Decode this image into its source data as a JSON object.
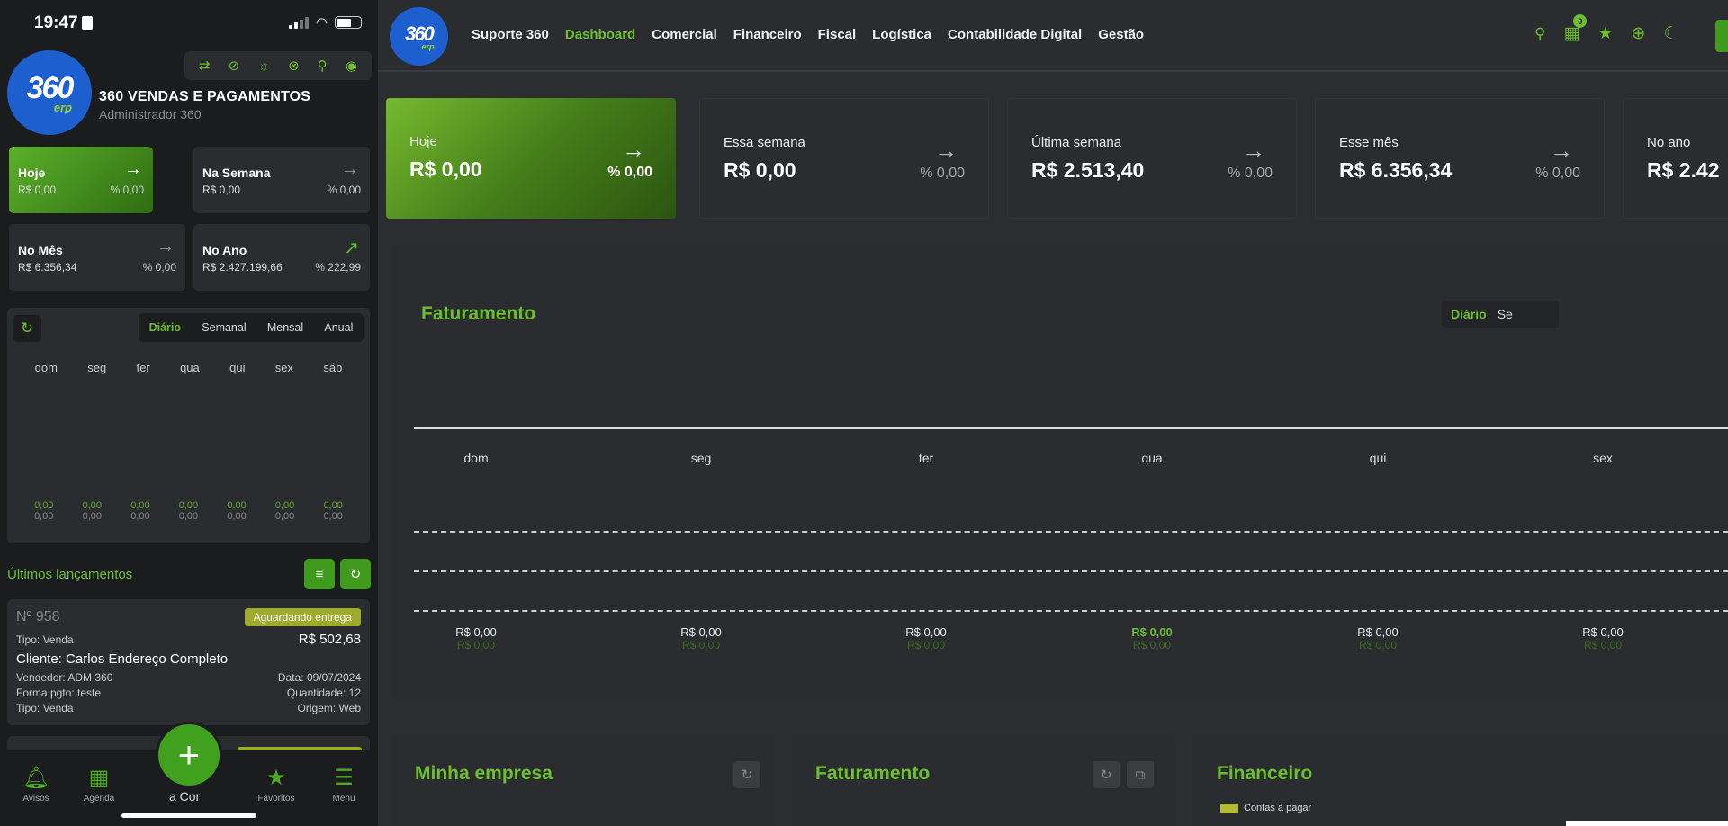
{
  "status": {
    "time": "19:47"
  },
  "profile": {
    "logo_main": "360",
    "logo_sub": "erp",
    "company": "360 VENDAS E PAGAMENTOS",
    "role": "Administrador  360"
  },
  "quick_icons": [
    "swap-icon",
    "no-location-icon",
    "brightness-icon",
    "eye-off-icon",
    "search-icon",
    "eye-icon"
  ],
  "m_cards": [
    {
      "title": "Hoje",
      "value": "R$ 0,00",
      "pct": "% 0,00",
      "arrow": "→"
    },
    {
      "title": "Na Semana",
      "value": "R$ 0,00",
      "pct": "% 0,00",
      "arrow": "→"
    },
    {
      "title": "No Mês",
      "value": "R$ 6.356,34",
      "pct": "% 0,00",
      "arrow": "→"
    },
    {
      "title": "No Ano",
      "value": "R$ 2.427.199,66",
      "pct": "% 222,99",
      "arrow": "↗"
    }
  ],
  "m_chart": {
    "tabs": [
      "Diário",
      "Semanal",
      "Mensal",
      "Anual"
    ],
    "days": [
      "dom",
      "seg",
      "ter",
      "qua",
      "qui",
      "sex",
      "sáb"
    ],
    "values_top": [
      "0,00",
      "0,00",
      "0,00",
      "0,00",
      "0,00",
      "0,00",
      "0,00"
    ],
    "values_bottom": [
      "0,00",
      "0,00",
      "0,00",
      "0,00",
      "0,00",
      "0,00",
      "0,00"
    ]
  },
  "latest": {
    "title": "Últimos lançamentos",
    "order": {
      "number": "Nº 958",
      "status": "Aguardando entrega",
      "type": "Tipo: Venda",
      "amount": "R$ 502,68",
      "client": "Cliente: Carlos Endereço Completo",
      "seller": "Vendedor: ADM 360",
      "date": "Data: 09/07/2024",
      "payment": "Forma pgto: teste",
      "quantity": "Quantidade: 12",
      "type2": "Tipo: Venda",
      "origin": "Origem: Web"
    }
  },
  "bottom_nav": {
    "avisos": "Avisos",
    "agenda": "Agenda",
    "fab_label": "a Cor",
    "favoritos": "Favoritos",
    "menu": "Menu"
  },
  "desktop": {
    "logo_main": "360",
    "logo_sub": "erp",
    "menu": [
      "Suporte 360",
      "Dashboard",
      "Comercial",
      "Financeiro",
      "Fiscal",
      "Logística",
      "Contabilidade Digital",
      "Gestão"
    ],
    "cart_count": "0",
    "kpis": [
      {
        "title": "Hoje",
        "value": "R$ 0,00",
        "pct": "% 0,00",
        "arrow": "→"
      },
      {
        "title": "Essa semana",
        "value": "R$ 0,00",
        "pct": "% 0,00",
        "arrow": "→"
      },
      {
        "title": "Última semana",
        "value": "R$ 2.513,40",
        "pct": "% 0,00",
        "arrow": "→"
      },
      {
        "title": "Esse mês",
        "value": "R$ 6.356,34",
        "pct": "% 0,00",
        "arrow": "→"
      },
      {
        "title": "No ano",
        "value": "R$ 2.42",
        "pct": "",
        "arrow": ""
      }
    ],
    "chart": {
      "title": "Faturamento",
      "tabs": [
        "Diário",
        "Se"
      ],
      "days": [
        "dom",
        "seg",
        "ter",
        "qua",
        "qui",
        "sex"
      ],
      "values_main": [
        "R$ 0,00",
        "R$ 0,00",
        "R$ 0,00",
        "R$ 0,00",
        "R$ 0,00",
        "R$ 0,00"
      ],
      "values_sub": [
        "R$ 0,00",
        "R$ 0,00",
        "R$ 0,00",
        "R$ 0,00",
        "R$ 0,00",
        "R$ 0,00"
      ]
    },
    "cards": {
      "empresa": "Minha empresa",
      "faturamento": "Faturamento",
      "financeiro": "Financeiro",
      "legend": "Contas à pagar"
    }
  },
  "colors": {
    "accent": "#6cbf2e",
    "brand_blue": "#1d5fcf",
    "badge": "#9fab2d"
  }
}
